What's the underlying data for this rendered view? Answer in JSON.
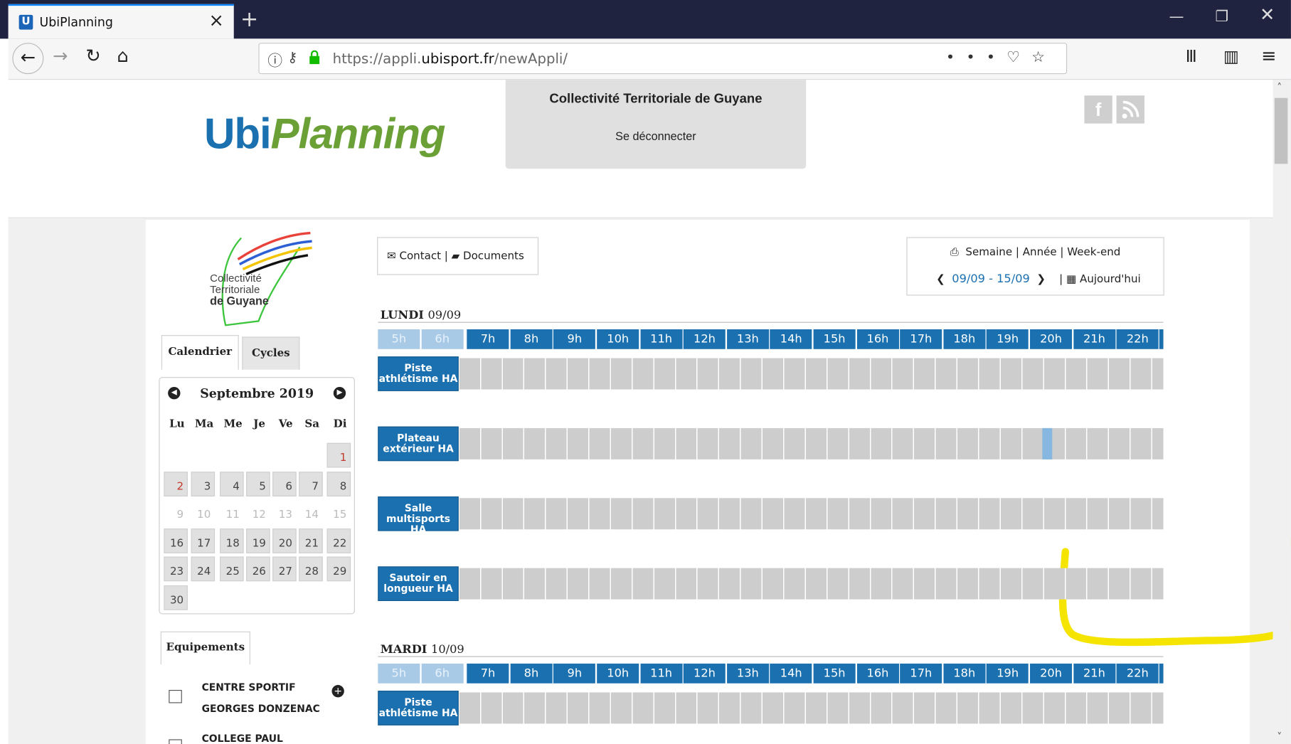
{
  "browser": {
    "tab_title": "UbiPlanning",
    "tab_favicon": "U",
    "url_prefix": "https://appli.",
    "url_domain": "ubisport.fr",
    "url_path": "/newAppli/"
  },
  "header": {
    "logo_ubi": "Ubi",
    "logo_planning": "Planning",
    "org_name": "Collectivité Territoriale de Guyane",
    "logout": "Se déconnecter",
    "social": [
      "f",
      "rss"
    ]
  },
  "sidebar": {
    "org_logo_lines": [
      "Collectivité",
      "Territoriale",
      "de Guyane"
    ],
    "tabs": [
      "Calendrier",
      "Cycles"
    ],
    "calendar": {
      "month": "Septembre 2019",
      "weekdays": [
        "Lu",
        "Ma",
        "Me",
        "Je",
        "Ve",
        "Sa",
        "Di"
      ],
      "weeks": [
        [
          "",
          "",
          "",
          "",
          "",
          "",
          "1"
        ],
        [
          "2",
          "3",
          "4",
          "5",
          "6",
          "7",
          "8"
        ],
        [
          "9",
          "10",
          "11",
          "12",
          "13",
          "14",
          "15"
        ],
        [
          "16",
          "17",
          "18",
          "19",
          "20",
          "21",
          "22"
        ],
        [
          "23",
          "24",
          "25",
          "26",
          "27",
          "28",
          "29"
        ],
        [
          "30",
          "",
          "",
          "",
          "",
          "",
          ""
        ]
      ],
      "red_days": [
        "1",
        "2"
      ],
      "current_week": [
        "9",
        "10",
        "11",
        "12",
        "13",
        "14",
        "15"
      ]
    },
    "equip_tab": "Equipements",
    "equipments": [
      "CENTRE SPORTIF GEORGES DONZENAC",
      "COLLEGE PAUL"
    ]
  },
  "toolbar": {
    "contact": "Contact",
    "documents": "Documents",
    "views": [
      "Semaine",
      "Année",
      "Week-end"
    ],
    "range": "09/09 - 15/09",
    "today": "Aujourd'hui"
  },
  "planning": {
    "hours": [
      "5h",
      "6h",
      "7h",
      "8h",
      "9h",
      "10h",
      "11h",
      "12h",
      "13h",
      "14h",
      "15h",
      "16h",
      "17h",
      "18h",
      "19h",
      "20h",
      "21h",
      "22h"
    ],
    "days": [
      {
        "name": "LUNDI",
        "date": "09/09",
        "resources": [
          {
            "line1": "Piste",
            "line2": "athlétisme HA"
          },
          {
            "line1": "Plateau",
            "line2": "extérieur HA"
          },
          {
            "line1": "Salle",
            "line2": "multisports HA"
          },
          {
            "line1": "Sautoir en",
            "line2": "longueur HA"
          }
        ]
      },
      {
        "name": "MARDI",
        "date": "10/09",
        "resources": [
          {
            "line1": "Piste",
            "line2": "athlétisme HA"
          }
        ]
      }
    ]
  },
  "colors": {
    "primary": "#1b70b0",
    "accent_green": "#6aa036",
    "highlight_annotation": "#f5e400"
  }
}
